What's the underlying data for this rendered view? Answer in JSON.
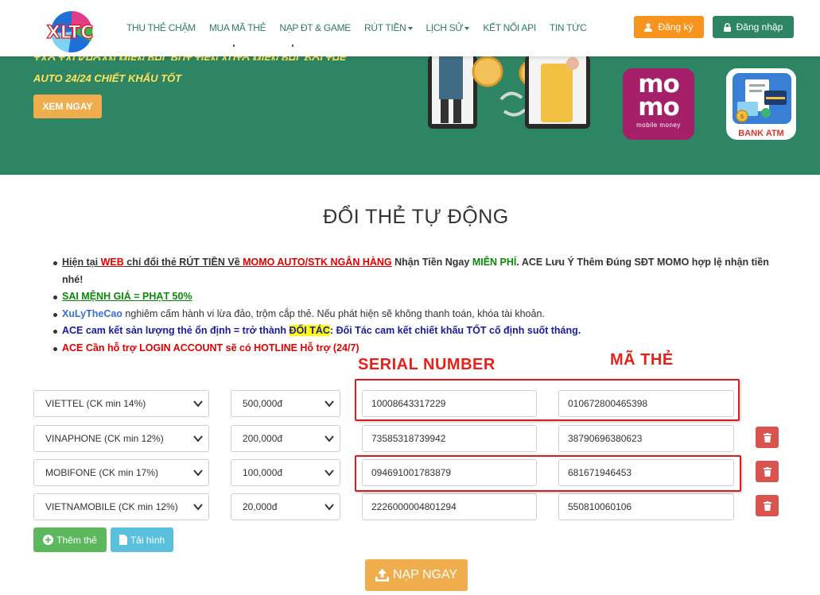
{
  "nav": {
    "logo_text": "XLTC",
    "items": [
      {
        "label": "THU THẺ CHẬM",
        "dropdown": false
      },
      {
        "label": "MUA MÃ THẺ",
        "dropdown": false
      },
      {
        "label": "NẠP ĐT & GAME",
        "dropdown": false
      },
      {
        "label": "RÚT TIỀN",
        "dropdown": true
      },
      {
        "label": "LỊCH SỬ",
        "dropdown": true
      },
      {
        "label": "KẾT NỐI API",
        "dropdown": false
      },
      {
        "label": "TIN TỨC",
        "dropdown": false
      }
    ],
    "register_label": "Đăng ký",
    "login_label": "Đăng nhập"
  },
  "hero": {
    "line1": "TẠO TÀI KHOẢN MIỄN PHÍ, RÚT TIỀN AUTO MIỄN PHÍ, ĐỔI THẺ",
    "line2": "AUTO 24/24 CHIẾT KHẤU TỐT",
    "cta_label": "XEM NGAY",
    "momo_top": "mo",
    "momo_bottom": "mo",
    "momo_caption": "mobile money",
    "bank_label": "BANK ATM"
  },
  "main": {
    "title": "ĐỔI THẺ TỰ ĐỘNG",
    "notes": {
      "n1_a": "Hiện tại ",
      "n1_b": "WEB",
      "n1_c": " chỉ đổi thẻ RÚT TIỀN Về ",
      "n1_d": "MOMO AUTO/STK NGÂN HÀNG",
      "n1_e": " Nhận Tiền Ngay ",
      "n1_f": "MIỄN PHÍ",
      "n1_g": ". ACE Lưu Ý Thêm Đúng SĐT MOMO hợp lệ nhận tiền nhé!",
      "n2": "SAI MỆNH GIÁ = PHẠT 50%",
      "n3_a": "XuLyTheCao",
      "n3_b": " nghiêm cấm hành vi lừa đảo, trộm cắp thẻ. Nếu phát hiện sẽ không thanh toán, khóa tài khoản.",
      "n4_a": "ACE cam kết sản lượng thẻ ổn định = trở thành ",
      "n4_b": "ĐỐI TÁC",
      "n4_c": ": Đối Tác cam kết chiết khấu TỐT cố định suốt tháng.",
      "n5": "ACE Cần hỗ trợ LOGIN ACCOUNT sẽ có HOTLINE Hỗ trợ (24/7)"
    },
    "annot_serial": "SERIAL NUMBER",
    "annot_code": "MÃ THẺ",
    "rows": [
      {
        "telco": "VIETTEL (CK min 14%)",
        "amount": "500,000đ",
        "serial": "10008643317229",
        "code": "010672800465398"
      },
      {
        "telco": "VINAPHONE (CK min 12%)",
        "amount": "200,000đ",
        "serial": "73585318739942",
        "code": "38790696380623"
      },
      {
        "telco": "MOBIFONE (CK min 17%)",
        "amount": "100,000đ",
        "serial": "094691001783879",
        "code": "681671946453"
      },
      {
        "telco": "VIETNAMOBILE (CK min 12%)",
        "amount": "20,000đ",
        "serial": "2226000004801294",
        "code": "550810060106"
      }
    ],
    "add_label": "Thêm thẻ",
    "upload_label": "Tải hình",
    "submit_label": "NẠP NGAY"
  },
  "colors": {
    "brand_green": "#2e8564",
    "accent_orange": "#f0ad4e",
    "danger": "#d9534f",
    "momo": "#a51f69"
  }
}
